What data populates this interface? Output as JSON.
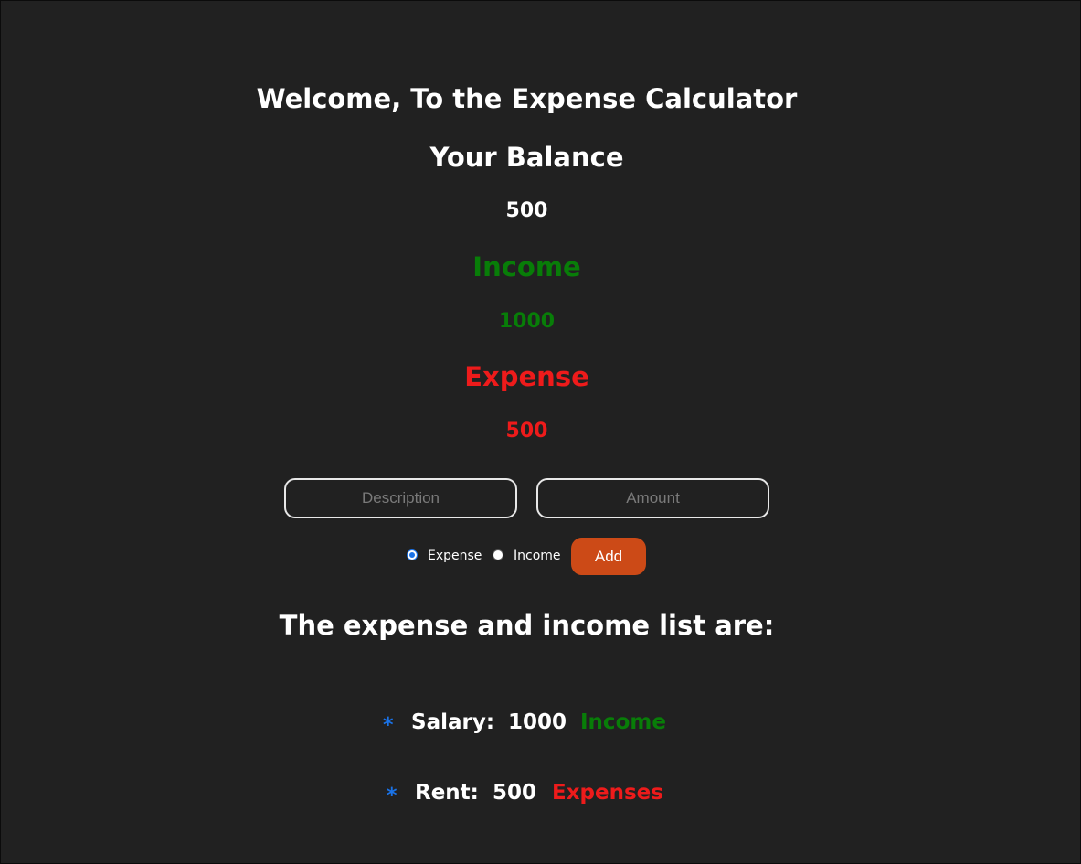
{
  "title": "Welcome, To the Expense Calculator",
  "balance": {
    "label": "Your Balance",
    "value": "500"
  },
  "income": {
    "label": "Income",
    "value": "1000"
  },
  "expense": {
    "label": "Expense",
    "value": "500"
  },
  "form": {
    "description_placeholder": "Description",
    "amount_placeholder": "Amount",
    "description_value": "",
    "amount_value": "",
    "radio_expense_label": "Expense",
    "radio_income_label": "Income",
    "selected_type": "Expense",
    "add_label": "Add"
  },
  "list": {
    "heading": "The expense and income list are:",
    "bullet": "*",
    "items": [
      {
        "description": "Salary:",
        "amount": "1000",
        "type": "Income"
      },
      {
        "description": "Rent:",
        "amount": "500",
        "type": "Expenses"
      }
    ]
  },
  "colors": {
    "background": "#212121",
    "income": "#087d08",
    "expense": "#ee1b1b",
    "add_button": "#cc4a17",
    "bullet": "#1a73e8"
  }
}
